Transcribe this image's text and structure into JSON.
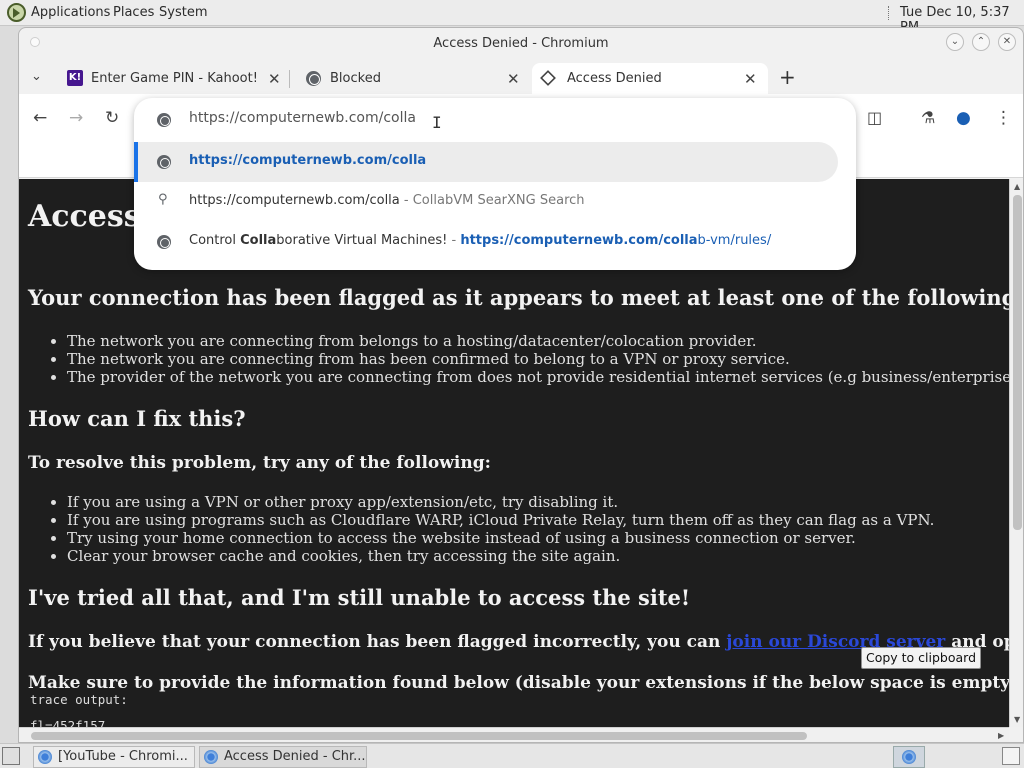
{
  "top_panel": {
    "applications": "Applications",
    "places": "Places",
    "system": "System",
    "clock": "Tue Dec 10,  5:37 PM"
  },
  "window": {
    "title": "Access Denied - Chromium"
  },
  "tabs": [
    {
      "label": "Enter Game PIN - Kahoot!",
      "favicon": "K!"
    },
    {
      "label": "Blocked"
    },
    {
      "label": "Access Denied"
    }
  ],
  "omnibox": {
    "input_value": "https://computernewb.com/colla",
    "suggestions": {
      "s0": "https://computernewb.com/colla",
      "s1_query": "https://computernewb.com/colla",
      "s1_sep": " - ",
      "s1_engine": "CollabVM SearXNG Search",
      "s2_pre": "Control ",
      "s2_bold": "Colla",
      "s2_rest": "borative Virtual Machines!",
      "s2_sep": " - ",
      "s2_url_bold": "https://computernewb.com/colla",
      "s2_url_rest": "b-vm/rules/"
    }
  },
  "page": {
    "heading": "Access Denied",
    "flagged_heading": "Your connection has been flagged as it appears to meet at least one of the following criteria:",
    "criteria": [
      "The network you are connecting from belongs to a hosting/datacenter/colocation provider.",
      "The network you are connecting from has been confirmed to belong to a VPN or proxy service.",
      "The provider of the network you are connecting from does not provide residential internet services (e.g business/enterprise-only networks)."
    ],
    "fix_heading": "How can I fix this?",
    "resolve_heading": "To resolve this problem, try any of the following:",
    "fixes": [
      "If you are using a VPN or other proxy app/extension/etc, try disabling it.",
      "If you are using programs such as Cloudflare WARP, iCloud Private Relay, turn them off as they can flag as a VPN.",
      "Try using your home connection to access the website instead of using a business connection or server.",
      "Clear your browser cache and cookies, then try accessing the site again."
    ],
    "tried_heading": "I've tried all that, and I'm still unable to access the site!",
    "incorrect_pre": "If you believe that your connection has been flagged incorrectly, you can ",
    "incorrect_link": "join our Discord server",
    "incorrect_post": " and open a ticket.",
    "provide_info": "Make sure to provide the information found below (disable your extensions if the below space is empty):",
    "copy_button": "Copy to clipboard",
    "trace_label": "trace output:",
    "trace_line": "fl=452f157"
  },
  "taskbar": {
    "task1": "[YouTube - Chromi...",
    "task2": "Access Denied - Chr..."
  },
  "colors": {
    "page_bg": "#1e1e1e",
    "link": "#2a48d8",
    "omni_link": "#1a5fb4",
    "accent": "#1a73e8"
  }
}
